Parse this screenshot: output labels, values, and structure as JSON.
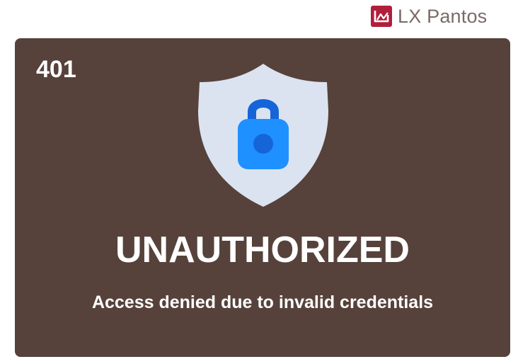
{
  "brand": {
    "name": "LX Pantos",
    "logo_icon": "lx-pantos-logo-icon",
    "logo_color": "#b01f3a"
  },
  "error": {
    "code": "401",
    "title": "UNAUTHORIZED",
    "message": "Access denied due to invalid credentials",
    "icon": "shield-lock-icon"
  },
  "colors": {
    "card_background": "#56423b",
    "text": "#ffffff",
    "shield": "#dbe3f1",
    "lock_body": "#1e90ff",
    "lock_shackle": "#1565d8"
  }
}
